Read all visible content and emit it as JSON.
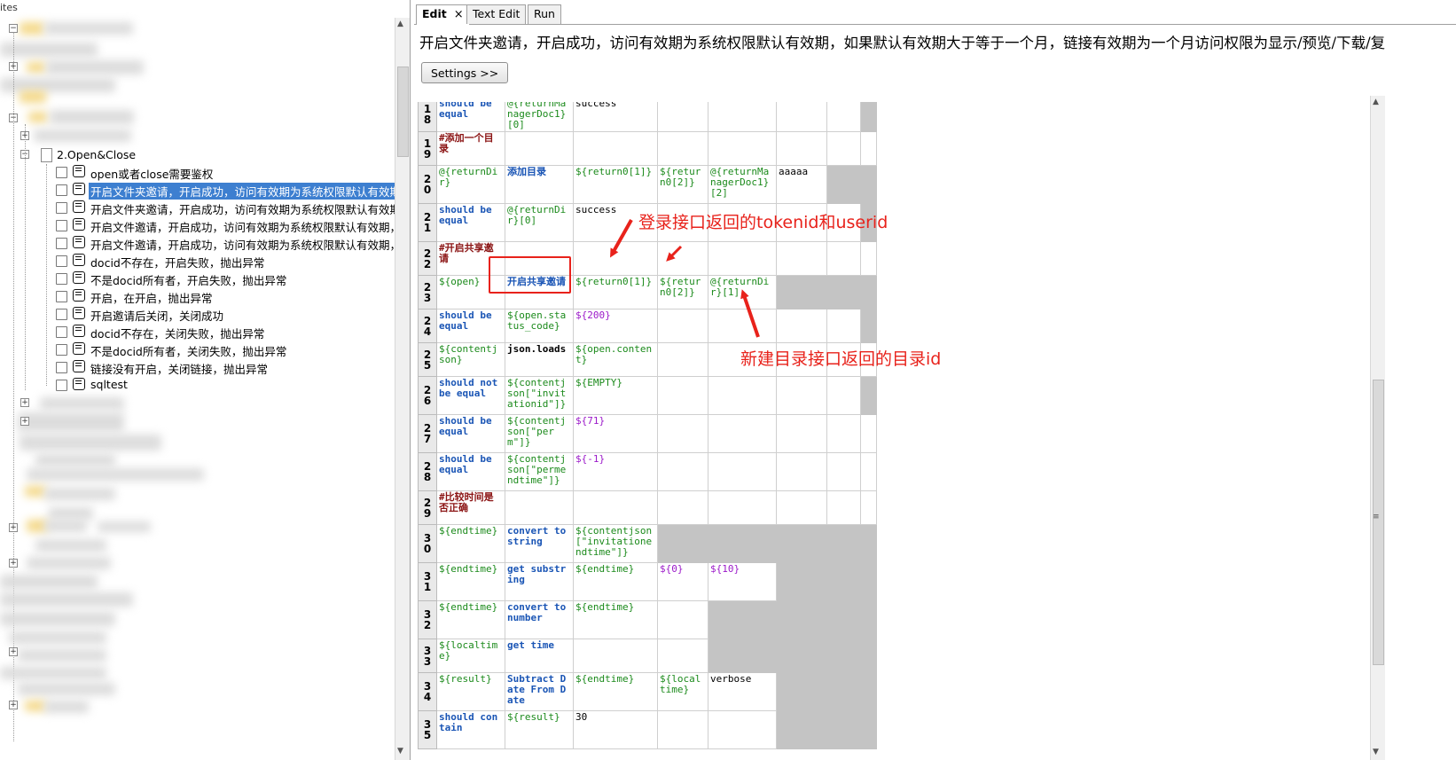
{
  "left_pane": {
    "title": "ites",
    "node_2": "2.Open&Close",
    "test_items": [
      {
        "label": "open或者close需要鉴权",
        "selected": false
      },
      {
        "label": "开启文件夹邀请，开启成功，访问有效期为系统权限默认有效期，...",
        "selected": true
      },
      {
        "label": "开启文件夹邀请，开启成功，访问有效期为系统权限默认有效期，...",
        "selected": false
      },
      {
        "label": "开启文件邀请，开启成功，访问有效期为系统权限默认有效期，如...",
        "selected": false
      },
      {
        "label": "开启文件邀请，开启成功，访问有效期为系统权限默认有效期，如...",
        "selected": false
      },
      {
        "label": "docid不存在，开启失败，抛出异常",
        "selected": false
      },
      {
        "label": "不是docid所有者，开启失败，抛出异常",
        "selected": false
      },
      {
        "label": "开启，在开启，抛出异常",
        "selected": false
      },
      {
        "label": "开启邀请后关闭，关闭成功",
        "selected": false
      },
      {
        "label": "docid不存在，关闭失败，抛出异常",
        "selected": false
      },
      {
        "label": "不是docid所有者，关闭失败，抛出异常",
        "selected": false
      },
      {
        "label": "链接没有开启，关闭链接，抛出异常",
        "selected": false
      },
      {
        "label": "sqltest",
        "selected": false
      }
    ]
  },
  "tabs": [
    {
      "label": "Edit",
      "active": true,
      "close": "×"
    },
    {
      "label": "Text Edit",
      "active": false
    },
    {
      "label": "Run",
      "active": false
    }
  ],
  "test_name": "开启文件夹邀请，开启成功，访问有效期为系统权限默认有效期，如果默认有效期大于等于一个月，链接有效期为一个月访问权限为显示/预览/下载/复",
  "settings_label": "Settings >>",
  "grid": {
    "rows": [
      {
        "n": "18",
        "cells": [
          {
            "t": "should be equal",
            "c": "kw"
          },
          {
            "t": "@{returnManagerDoc1}[0]",
            "c": "var"
          },
          {
            "t": "success",
            "c": "plain"
          },
          {
            "t": "",
            "c": ""
          },
          {
            "t": "",
            "c": ""
          },
          {
            "t": "",
            "c": ""
          },
          {
            "t": "",
            "c": ""
          },
          {
            "t": "",
            "c": "gray"
          }
        ]
      },
      {
        "n": "19",
        "cells": [
          {
            "t": "#添加一个目录",
            "c": "comment"
          },
          {
            "t": "",
            "c": ""
          },
          {
            "t": "",
            "c": ""
          },
          {
            "t": "",
            "c": ""
          },
          {
            "t": "",
            "c": ""
          },
          {
            "t": "",
            "c": ""
          },
          {
            "t": "",
            "c": ""
          },
          {
            "t": "",
            "c": ""
          }
        ]
      },
      {
        "n": "20",
        "cells": [
          {
            "t": "@{returnDir}",
            "c": "var"
          },
          {
            "t": "添加目录",
            "c": "kw"
          },
          {
            "t": "${return0[1]}",
            "c": "var"
          },
          {
            "t": "${return0[2]}",
            "c": "var"
          },
          {
            "t": "@{returnManagerDoc1}[2]",
            "c": "var"
          },
          {
            "t": "aaaaa",
            "c": "plain"
          },
          {
            "t": "",
            "c": "gray"
          },
          {
            "t": "",
            "c": "gray"
          }
        ]
      },
      {
        "n": "21",
        "cells": [
          {
            "t": "should be equal",
            "c": "kw"
          },
          {
            "t": "@{returnDir}[0]",
            "c": "var"
          },
          {
            "t": "success",
            "c": "plain"
          },
          {
            "t": "",
            "c": ""
          },
          {
            "t": "",
            "c": ""
          },
          {
            "t": "",
            "c": ""
          },
          {
            "t": "",
            "c": ""
          },
          {
            "t": "",
            "c": "gray"
          }
        ]
      },
      {
        "n": "22",
        "cells": [
          {
            "t": "#开启共享邀请",
            "c": "comment"
          },
          {
            "t": "",
            "c": ""
          },
          {
            "t": "",
            "c": ""
          },
          {
            "t": "",
            "c": ""
          },
          {
            "t": "",
            "c": ""
          },
          {
            "t": "",
            "c": ""
          },
          {
            "t": "",
            "c": ""
          },
          {
            "t": "",
            "c": ""
          }
        ]
      },
      {
        "n": "23",
        "cells": [
          {
            "t": "${open}",
            "c": "var"
          },
          {
            "t": "开启共享邀请",
            "c": "kw"
          },
          {
            "t": "${return0[1]}",
            "c": "var"
          },
          {
            "t": "${return0[2]}",
            "c": "var"
          },
          {
            "t": "@{returnDir}[1]",
            "c": "var"
          },
          {
            "t": "",
            "c": "gray"
          },
          {
            "t": "",
            "c": "gray"
          },
          {
            "t": "",
            "c": "gray"
          }
        ]
      },
      {
        "n": "24",
        "cells": [
          {
            "t": "should be equal",
            "c": "kw"
          },
          {
            "t": "${open.status_code}",
            "c": "var"
          },
          {
            "t": "${200}",
            "c": "purple"
          },
          {
            "t": "",
            "c": ""
          },
          {
            "t": "",
            "c": ""
          },
          {
            "t": "",
            "c": ""
          },
          {
            "t": "",
            "c": ""
          },
          {
            "t": "",
            "c": "gray"
          }
        ]
      },
      {
        "n": "25",
        "cells": [
          {
            "t": "${contentjson}",
            "c": "var"
          },
          {
            "t": "json.loads",
            "c": "blk"
          },
          {
            "t": "${open.content}",
            "c": "var"
          },
          {
            "t": "",
            "c": ""
          },
          {
            "t": "",
            "c": ""
          },
          {
            "t": "",
            "c": ""
          },
          {
            "t": "",
            "c": ""
          },
          {
            "t": "",
            "c": ""
          }
        ]
      },
      {
        "n": "26",
        "cells": [
          {
            "t": "should not be equal",
            "c": "kw"
          },
          {
            "t": "${contentjson[\"invitationid\"]}",
            "c": "var"
          },
          {
            "t": "${EMPTY}",
            "c": "var"
          },
          {
            "t": "",
            "c": ""
          },
          {
            "t": "",
            "c": ""
          },
          {
            "t": "",
            "c": ""
          },
          {
            "t": "",
            "c": ""
          },
          {
            "t": "",
            "c": "gray"
          }
        ]
      },
      {
        "n": "27",
        "cells": [
          {
            "t": "should be equal",
            "c": "kw"
          },
          {
            "t": "${contentjson[\"perm\"]}",
            "c": "var"
          },
          {
            "t": "${71}",
            "c": "purple"
          },
          {
            "t": "",
            "c": ""
          },
          {
            "t": "",
            "c": ""
          },
          {
            "t": "",
            "c": ""
          },
          {
            "t": "",
            "c": ""
          },
          {
            "t": "",
            "c": ""
          }
        ]
      },
      {
        "n": "28",
        "cells": [
          {
            "t": "should be equal",
            "c": "kw"
          },
          {
            "t": "${contentjson[\"permendtime\"]}",
            "c": "var"
          },
          {
            "t": "${-1}",
            "c": "purple"
          },
          {
            "t": "",
            "c": ""
          },
          {
            "t": "",
            "c": ""
          },
          {
            "t": "",
            "c": ""
          },
          {
            "t": "",
            "c": ""
          },
          {
            "t": "",
            "c": ""
          }
        ]
      },
      {
        "n": "29",
        "cells": [
          {
            "t": "#比较时间是否正确",
            "c": "comment"
          },
          {
            "t": "",
            "c": ""
          },
          {
            "t": "",
            "c": ""
          },
          {
            "t": "",
            "c": ""
          },
          {
            "t": "",
            "c": ""
          },
          {
            "t": "",
            "c": ""
          },
          {
            "t": "",
            "c": ""
          },
          {
            "t": "",
            "c": ""
          }
        ]
      },
      {
        "n": "30",
        "cells": [
          {
            "t": "${endtime}",
            "c": "var"
          },
          {
            "t": "convert to string",
            "c": "kw"
          },
          {
            "t": "${contentjson[\"invitationendtime\"]}",
            "c": "var"
          },
          {
            "t": "",
            "c": "gray"
          },
          {
            "t": "",
            "c": "gray"
          },
          {
            "t": "",
            "c": "gray"
          },
          {
            "t": "",
            "c": "gray"
          },
          {
            "t": "",
            "c": "gray"
          }
        ]
      },
      {
        "n": "31",
        "cells": [
          {
            "t": "${endtime}",
            "c": "var"
          },
          {
            "t": "get substring",
            "c": "kw"
          },
          {
            "t": "${endtime}",
            "c": "var"
          },
          {
            "t": "${0}",
            "c": "purple"
          },
          {
            "t": "${10}",
            "c": "purple"
          },
          {
            "t": "",
            "c": "gray"
          },
          {
            "t": "",
            "c": "gray"
          },
          {
            "t": "",
            "c": "gray"
          }
        ]
      },
      {
        "n": "32",
        "cells": [
          {
            "t": "${endtime}",
            "c": "var"
          },
          {
            "t": "convert to number",
            "c": "kw"
          },
          {
            "t": "${endtime}",
            "c": "var"
          },
          {
            "t": "",
            "c": ""
          },
          {
            "t": "",
            "c": "gray"
          },
          {
            "t": "",
            "c": "gray"
          },
          {
            "t": "",
            "c": "gray"
          },
          {
            "t": "",
            "c": "gray"
          }
        ]
      },
      {
        "n": "33",
        "cells": [
          {
            "t": "${localtime}",
            "c": "var"
          },
          {
            "t": "get time",
            "c": "kw"
          },
          {
            "t": "",
            "c": ""
          },
          {
            "t": "",
            "c": ""
          },
          {
            "t": "",
            "c": "gray"
          },
          {
            "t": "",
            "c": "gray"
          },
          {
            "t": "",
            "c": "gray"
          },
          {
            "t": "",
            "c": "gray"
          }
        ]
      },
      {
        "n": "34",
        "cells": [
          {
            "t": "${result}",
            "c": "var"
          },
          {
            "t": "Subtract Date From Date",
            "c": "kw"
          },
          {
            "t": "${endtime}",
            "c": "var"
          },
          {
            "t": "${localtime}",
            "c": "var"
          },
          {
            "t": "verbose",
            "c": "plain"
          },
          {
            "t": "",
            "c": "gray"
          },
          {
            "t": "",
            "c": "gray"
          },
          {
            "t": "",
            "c": "gray"
          }
        ]
      },
      {
        "n": "35",
        "cells": [
          {
            "t": "should contain",
            "c": "kw"
          },
          {
            "t": "${result}",
            "c": "var"
          },
          {
            "t": "30",
            "c": "plain"
          },
          {
            "t": "",
            "c": ""
          },
          {
            "t": "",
            "c": ""
          },
          {
            "t": "",
            "c": "gray"
          },
          {
            "t": "",
            "c": "gray"
          },
          {
            "t": "",
            "c": "gray"
          }
        ]
      }
    ]
  },
  "annotations": {
    "label_token": "登录接口返回的tokenid和userid",
    "label_dir": "新建目录接口返回的目录id",
    "color": "#e8221b"
  }
}
